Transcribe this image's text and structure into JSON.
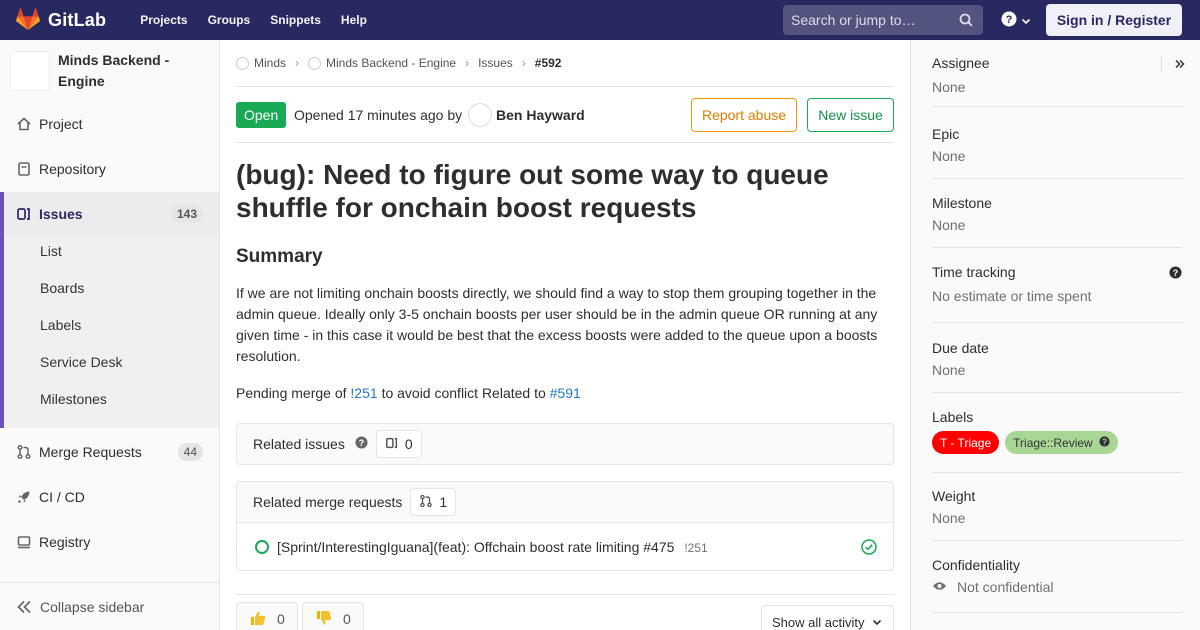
{
  "navbar": {
    "brand": "GitLab",
    "links": [
      "Projects",
      "Groups",
      "Snippets",
      "Help"
    ],
    "search_placeholder": "Search or jump to…",
    "sign_in": "Sign in / Register"
  },
  "sidebar": {
    "project_name": "Minds Backend - Engine",
    "items": [
      {
        "label": "Project",
        "icon": "home-icon"
      },
      {
        "label": "Repository",
        "icon": "doc-icon"
      },
      {
        "label": "Issues",
        "icon": "issues-icon",
        "count": "143"
      },
      {
        "label": "Merge Requests",
        "icon": "merge-request-icon",
        "count": "44"
      },
      {
        "label": "CI / CD",
        "icon": "rocket-icon"
      },
      {
        "label": "Registry",
        "icon": "container-icon"
      }
    ],
    "issues_sub": [
      "List",
      "Boards",
      "Labels",
      "Service Desk",
      "Milestones"
    ],
    "collapse": "Collapse sidebar"
  },
  "breadcrumb": {
    "items": [
      "Minds",
      "Minds Backend - Engine",
      "Issues"
    ],
    "current": "#592"
  },
  "issue": {
    "status": "Open",
    "opened_text": "Opened 17 minutes ago by",
    "author": "Ben Hayward",
    "report_abuse": "Report abuse",
    "new_issue": "New issue",
    "title": "(bug): Need to figure out some way to queue shuffle for onchain boost requests",
    "summary_heading": "Summary",
    "description": "If we are not limiting onchain boosts directly, we should find a way to stop them grouping together in the admin queue. Ideally only 3-5 onchain boosts per user should be in the admin queue OR running at any given time - in this case it would be best that the excess boosts were added to the queue upon a boosts resolution.",
    "pending_prefix": "Pending merge of",
    "pending_mr": "!251",
    "pending_mid": "to avoid conflict Related to",
    "pending_issue": "#591"
  },
  "related_issues": {
    "title": "Related issues",
    "count": "0"
  },
  "related_mrs": {
    "title": "Related merge requests",
    "count": "1",
    "items": [
      {
        "title": "[Sprint/InterestingIguana](feat): Offchain boost rate limiting #475",
        "ref": "!251"
      }
    ]
  },
  "awards": [
    {
      "icon": "thumbs-up-icon",
      "count": "0"
    },
    {
      "icon": "thumbs-down-icon",
      "count": "0"
    }
  ],
  "activity_filter": "Show all activity",
  "right_sidebar": {
    "assignee": {
      "label": "Assignee",
      "value": "None"
    },
    "epic": {
      "label": "Epic",
      "value": "None"
    },
    "milestone": {
      "label": "Milestone",
      "value": "None"
    },
    "time_tracking": {
      "label": "Time tracking",
      "value": "No estimate or time spent"
    },
    "due_date": {
      "label": "Due date",
      "value": "None"
    },
    "labels": {
      "label": "Labels",
      "items": [
        "T - Triage",
        "Triage::Review"
      ]
    },
    "weight": {
      "label": "Weight",
      "value": "None"
    },
    "confidentiality": {
      "label": "Confidentiality",
      "value": "Not confidential"
    }
  },
  "colors": {
    "navbar": "#292961",
    "open_badge": "#1aaa55",
    "report_abuse": "#fc9403",
    "label_triage": "#ff0000",
    "label_review": "#a8d695",
    "link": "#1f78d1",
    "active_bar": "#6b4fbb"
  }
}
